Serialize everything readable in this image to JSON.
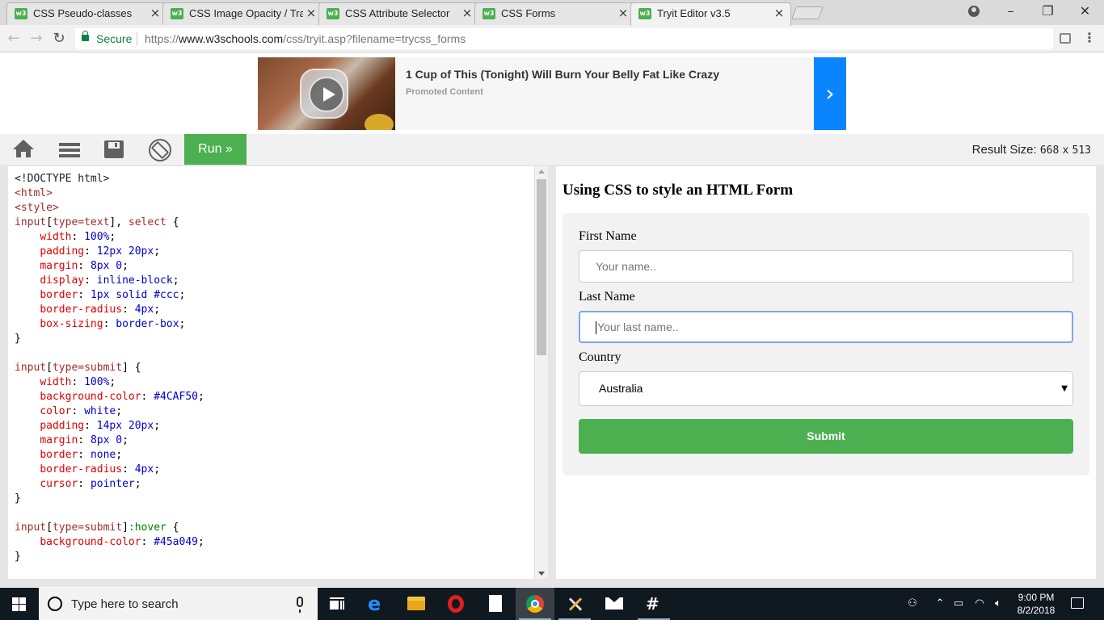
{
  "browser": {
    "tabs": [
      {
        "title": "CSS Pseudo-classes",
        "active": false
      },
      {
        "title": "CSS Image Opacity / Tran",
        "active": false
      },
      {
        "title": "CSS Attribute Selector",
        "active": false
      },
      {
        "title": "CSS Forms",
        "active": false
      },
      {
        "title": "Tryit Editor v3.5",
        "active": true
      }
    ],
    "favicon_text": "w3",
    "address": {
      "secure_label": "Secure",
      "url_prefix": "https://",
      "url_host": "www.w3schools.com",
      "url_path": "/css/tryit.asp?filename=trycss_forms"
    },
    "accent_color": "#0b8043"
  },
  "ad": {
    "title": "1 Cup of This (Tonight) Will Burn Your Belly Fat Like Crazy",
    "subtitle": "Promoted Content",
    "arrow": "›"
  },
  "tryit_toolbar": {
    "run_label": "Run »",
    "result_size_label": "Result Size:",
    "result_width": "668",
    "result_x": "x",
    "result_height": "513",
    "run_color": "#4caf50"
  },
  "code_lines": [
    [
      [
        "doc",
        "<!DOCTYPE html>"
      ]
    ],
    [
      [
        "tag",
        "<html>"
      ]
    ],
    [
      [
        "tag",
        "<style>"
      ]
    ],
    [
      [
        "sel",
        "input"
      ],
      [
        "pun",
        "["
      ],
      [
        "sel",
        "type=text"
      ],
      [
        "pun",
        "], "
      ],
      [
        "sel",
        "select"
      ],
      [
        "pun",
        " {"
      ]
    ],
    [
      [
        "pun",
        "    "
      ],
      [
        "prop",
        "width"
      ],
      [
        "pun",
        ": "
      ],
      [
        "val",
        "100%"
      ],
      [
        "pun",
        ";"
      ]
    ],
    [
      [
        "pun",
        "    "
      ],
      [
        "prop",
        "padding"
      ],
      [
        "pun",
        ": "
      ],
      [
        "val",
        "12px 20px"
      ],
      [
        "pun",
        ";"
      ]
    ],
    [
      [
        "pun",
        "    "
      ],
      [
        "prop",
        "margin"
      ],
      [
        "pun",
        ": "
      ],
      [
        "val",
        "8px 0"
      ],
      [
        "pun",
        ";"
      ]
    ],
    [
      [
        "pun",
        "    "
      ],
      [
        "prop",
        "display"
      ],
      [
        "pun",
        ": "
      ],
      [
        "val",
        "inline-block"
      ],
      [
        "pun",
        ";"
      ]
    ],
    [
      [
        "pun",
        "    "
      ],
      [
        "prop",
        "border"
      ],
      [
        "pun",
        ": "
      ],
      [
        "val",
        "1px solid #ccc"
      ],
      [
        "pun",
        ";"
      ]
    ],
    [
      [
        "pun",
        "    "
      ],
      [
        "prop",
        "border-radius"
      ],
      [
        "pun",
        ": "
      ],
      [
        "val",
        "4px"
      ],
      [
        "pun",
        ";"
      ]
    ],
    [
      [
        "pun",
        "    "
      ],
      [
        "prop",
        "box-sizing"
      ],
      [
        "pun",
        ": "
      ],
      [
        "val",
        "border-box"
      ],
      [
        "pun",
        ";"
      ]
    ],
    [
      [
        "pun",
        "}"
      ]
    ],
    [
      [
        "pun",
        ""
      ]
    ],
    [
      [
        "sel",
        "input"
      ],
      [
        "pun",
        "["
      ],
      [
        "sel",
        "type=submit"
      ],
      [
        "pun",
        "] {"
      ]
    ],
    [
      [
        "pun",
        "    "
      ],
      [
        "prop",
        "width"
      ],
      [
        "pun",
        ": "
      ],
      [
        "val",
        "100%"
      ],
      [
        "pun",
        ";"
      ]
    ],
    [
      [
        "pun",
        "    "
      ],
      [
        "prop",
        "background-color"
      ],
      [
        "pun",
        ": "
      ],
      [
        "val",
        "#4CAF50"
      ],
      [
        "pun",
        ";"
      ]
    ],
    [
      [
        "pun",
        "    "
      ],
      [
        "prop",
        "color"
      ],
      [
        "pun",
        ": "
      ],
      [
        "val",
        "white"
      ],
      [
        "pun",
        ";"
      ]
    ],
    [
      [
        "pun",
        "    "
      ],
      [
        "prop",
        "padding"
      ],
      [
        "pun",
        ": "
      ],
      [
        "val",
        "14px 20px"
      ],
      [
        "pun",
        ";"
      ]
    ],
    [
      [
        "pun",
        "    "
      ],
      [
        "prop",
        "margin"
      ],
      [
        "pun",
        ": "
      ],
      [
        "val",
        "8px 0"
      ],
      [
        "pun",
        ";"
      ]
    ],
    [
      [
        "pun",
        "    "
      ],
      [
        "prop",
        "border"
      ],
      [
        "pun",
        ": "
      ],
      [
        "val",
        "none"
      ],
      [
        "pun",
        ";"
      ]
    ],
    [
      [
        "pun",
        "    "
      ],
      [
        "prop",
        "border-radius"
      ],
      [
        "pun",
        ": "
      ],
      [
        "val",
        "4px"
      ],
      [
        "pun",
        ";"
      ]
    ],
    [
      [
        "pun",
        "    "
      ],
      [
        "prop",
        "cursor"
      ],
      [
        "pun",
        ": "
      ],
      [
        "val",
        "pointer"
      ],
      [
        "pun",
        ";"
      ]
    ],
    [
      [
        "pun",
        "}"
      ]
    ],
    [
      [
        "pun",
        ""
      ]
    ],
    [
      [
        "sel",
        "input"
      ],
      [
        "pun",
        "["
      ],
      [
        "sel",
        "type=submit"
      ],
      [
        "pun",
        "]"
      ],
      [
        "pseudo",
        ":hover"
      ],
      [
        "pun",
        " {"
      ]
    ],
    [
      [
        "pun",
        "    "
      ],
      [
        "prop",
        "background-color"
      ],
      [
        "pun",
        ": "
      ],
      [
        "val",
        "#45a049"
      ],
      [
        "pun",
        ";"
      ]
    ],
    [
      [
        "pun",
        "}"
      ]
    ]
  ],
  "result": {
    "heading": "Using CSS to style an HTML Form",
    "first_name_label": "First Name",
    "first_name_placeholder": "Your name..",
    "last_name_label": "Last Name",
    "last_name_placeholder": "Your last name..",
    "country_label": "Country",
    "country_selected": "Australia",
    "select_arrow": "▼",
    "submit_label": "Submit"
  },
  "taskbar": {
    "search_placeholder": "Type here to search",
    "time": "9:00 PM",
    "date": "8/2/2018",
    "apps": [
      "task-view",
      "edge",
      "file-explorer",
      "opera",
      "notepad",
      "chrome",
      "tools",
      "mail",
      "slack"
    ]
  }
}
